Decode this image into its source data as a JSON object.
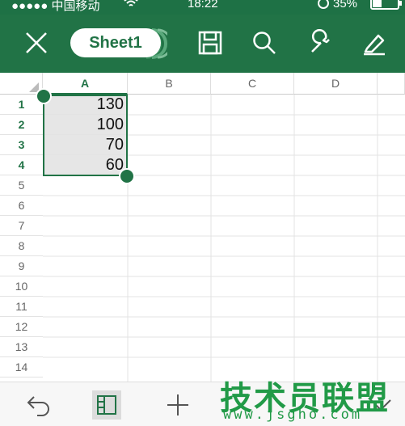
{
  "status_bar": {
    "carrier": "●●●●● 中国移动",
    "time": "18:22",
    "battery": "35%"
  },
  "toolbar": {
    "sheet_tab": "Sheet1",
    "icons": [
      "close-icon",
      "save-icon",
      "search-icon",
      "wrench-icon",
      "edit-icon"
    ]
  },
  "grid": {
    "column_headers": [
      "A",
      "B",
      "C",
      "D"
    ],
    "row_headers": [
      "1",
      "2",
      "3",
      "4",
      "5",
      "6",
      "7",
      "8",
      "9",
      "10",
      "11",
      "12",
      "13",
      "14"
    ],
    "cells_a": [
      "130",
      "100",
      "70",
      "60"
    ],
    "selection": "A1:A4"
  },
  "bottom_bar": {
    "icons": [
      "undo-icon",
      "panel-icon",
      "add-icon",
      "chevron-down-icon"
    ]
  },
  "watermark": {
    "title": "技术员联盟",
    "url": "www.jsgho.com"
  },
  "colors": {
    "accent": "#217346",
    "selection_fill": "#e6e6e6"
  }
}
